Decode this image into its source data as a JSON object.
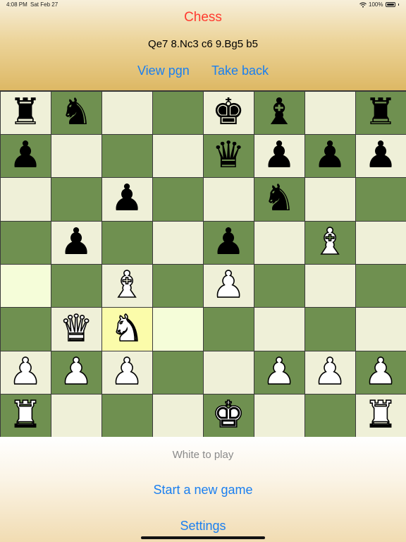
{
  "status_bar": {
    "time": "4:08 PM",
    "date": "Sat Feb 27",
    "battery": "100%"
  },
  "header": {
    "title": "Chess",
    "moves": "Qe7 8.Nc3 c6 9.Bg5 b5",
    "view_pgn": "View pgn",
    "take_back": "Take back"
  },
  "board": {
    "squares": [
      [
        "♜",
        "♞",
        "",
        "",
        "♚",
        "♝",
        "",
        "♜"
      ],
      [
        "♟",
        "",
        "",
        "",
        "♛",
        "♟",
        "♟",
        "♟"
      ],
      [
        "",
        "",
        "♟",
        "",
        "",
        "♞",
        "",
        ""
      ],
      [
        "",
        "♟",
        "",
        "",
        "♟",
        "",
        "♗",
        ""
      ],
      [
        "",
        "",
        "♗",
        "",
        "♙",
        "",
        "",
        ""
      ],
      [
        "",
        "♕",
        "♘",
        "",
        "",
        "",
        "",
        ""
      ],
      [
        "♙",
        "♙",
        "♙",
        "",
        "",
        "♙",
        "♙",
        "♙"
      ],
      [
        "♖",
        "",
        "",
        "",
        "♔",
        "",
        "",
        "♖"
      ]
    ],
    "highlighted": {
      "a4": "last-move",
      "d3": "last-move",
      "c3": "selected"
    }
  },
  "footer": {
    "status": "White to play",
    "new_game": "Start a new game",
    "settings": "Settings"
  },
  "colors": {
    "light_square": "#eff0d8",
    "dark_square": "#6f9050",
    "highlight_light": "#f5fdd9",
    "highlight_dark": "#8fb070",
    "selected": "#fbfcaa",
    "title": "#ff3b30",
    "link": "#1a7ff0"
  }
}
